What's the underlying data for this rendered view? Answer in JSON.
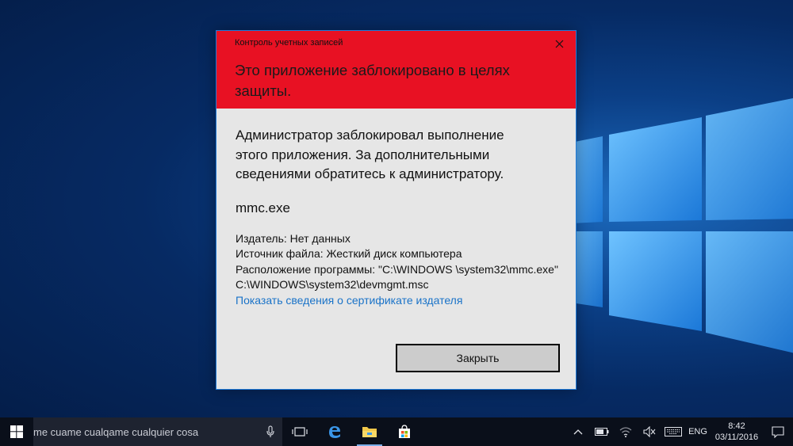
{
  "dialog": {
    "caption": "Контроль учетных записей",
    "heading": "Это приложение заблокировано в целях защиты.",
    "message": "Администратор заблокировал выполнение этого приложения. За дополнительными сведениями обратитесь к администратору.",
    "file_name": "mmc.exe",
    "publisher": "Издатель: Нет данных",
    "file_source": "Источник файла: Жесткий диск компьютера",
    "program_location": "Расположение программы: \"C:\\WINDOWS \\system32\\mmc.exe\" C:\\WINDOWS\\system32\\devmgmt.msc",
    "certificate_link": "Показать сведения о сертификате издателя",
    "close_button": "Закрыть",
    "close_icon": "close-icon",
    "header_color": "#e81123"
  },
  "taskbar": {
    "search_text": "me cuame cualqame cualquier cosa",
    "language": "ENG",
    "time": "8:42",
    "date": "03/11/2016",
    "icons": [
      "windows-start-icon",
      "microphone-icon",
      "task-view-icon",
      "edge-icon",
      "file-explorer-icon",
      "store-icon",
      "chevron-up-icon",
      "battery-icon",
      "wifi-icon",
      "volume-muted-icon",
      "keyboard-icon",
      "notification-icon"
    ]
  }
}
